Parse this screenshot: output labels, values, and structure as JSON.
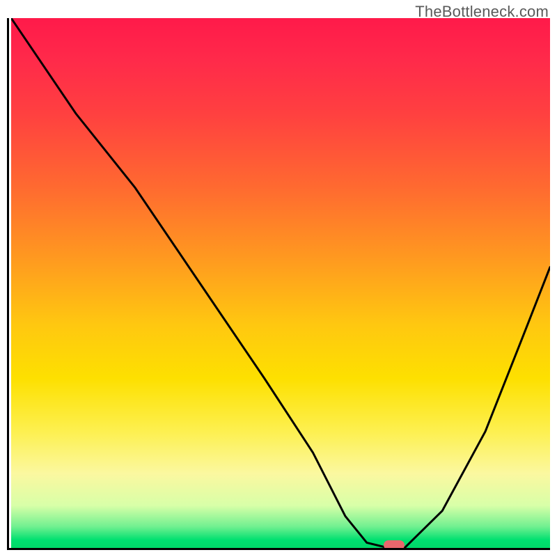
{
  "watermark": "TheBottleneck.com",
  "chart_data": {
    "type": "line",
    "title": "",
    "xlabel": "",
    "ylabel": "",
    "xlim": [
      0,
      100
    ],
    "ylim": [
      0,
      100
    ],
    "series": [
      {
        "name": "bottleneck-curve",
        "x": [
          0,
          12,
          23,
          35,
          47,
          56,
          62,
          66,
          70,
          73,
          80,
          88,
          95,
          100
        ],
        "values": [
          100,
          82,
          68,
          50,
          32,
          18,
          6,
          1,
          0,
          0,
          7,
          22,
          40,
          53
        ]
      }
    ],
    "marker": {
      "x": 71,
      "y": 0
    },
    "background_gradient": {
      "top": "#ff1a4a",
      "mid": "#fde000",
      "bottom": "#00d868"
    }
  }
}
